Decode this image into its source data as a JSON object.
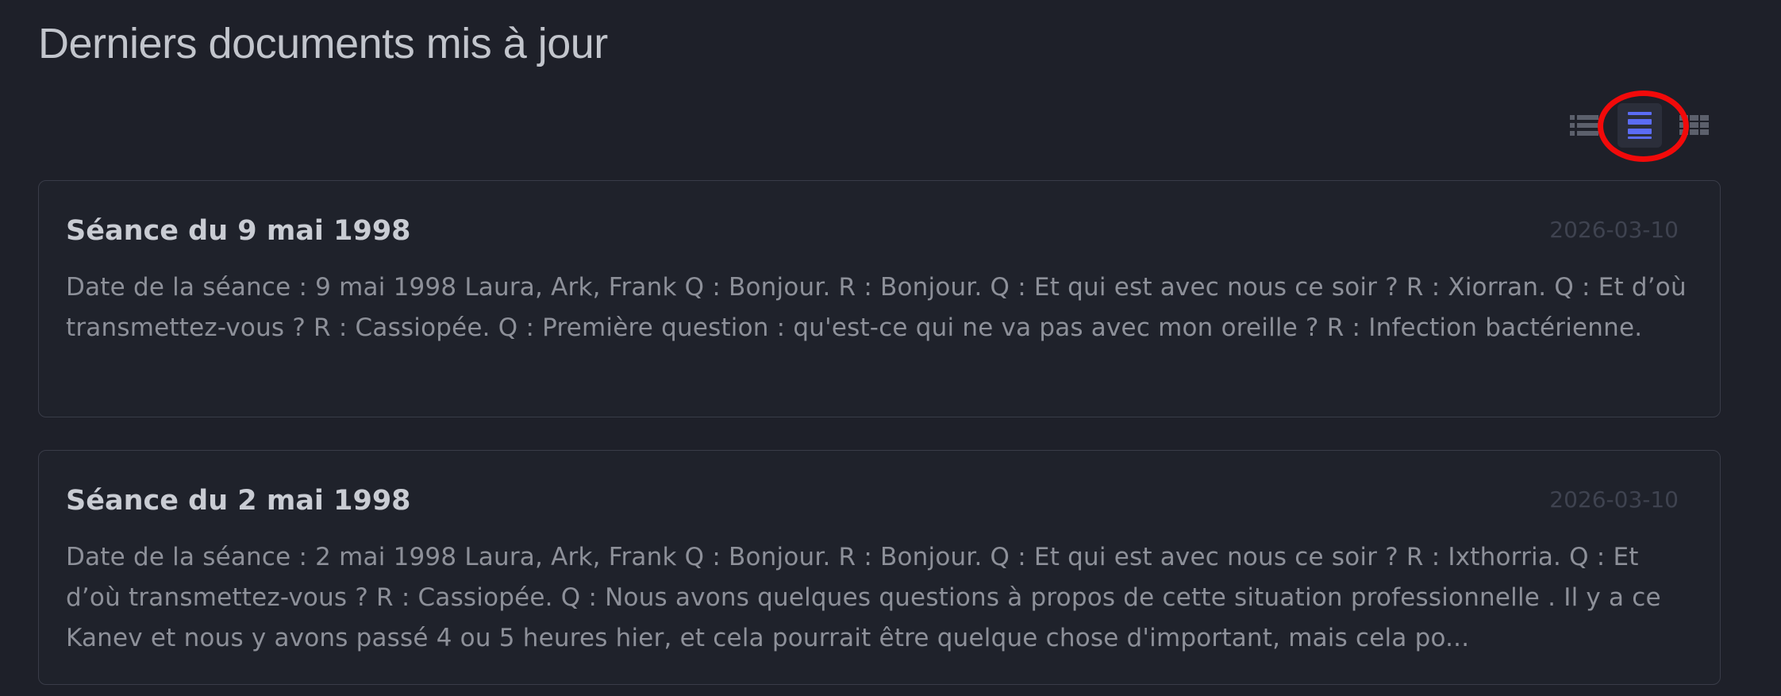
{
  "page": {
    "title": "Derniers documents mis à jour"
  },
  "view_switcher": {
    "options": [
      {
        "icon": "list-view-icon",
        "active": false
      },
      {
        "icon": "card-view-icon",
        "active": true
      },
      {
        "icon": "grid-view-icon",
        "active": false
      }
    ],
    "highlight_color": "#f20a0a",
    "active_color": "#5b6cf5"
  },
  "documents": [
    {
      "title": "Séance du 9 mai 1998",
      "date": "2026-03-10",
      "excerpt": "Date de la séance : 9 mai 1998 Laura, Ark, Frank Q : Bonjour. R : Bonjour. Q : Et qui est avec nous ce soir ? R : Xiorran. Q : Et d’où transmettez-vous ? R : Cassiopée. Q : Première question : qu'est-ce qui ne va pas avec mon oreille ? R : Infection bactérienne."
    },
    {
      "title": "Séance du 2 mai 1998",
      "date": "2026-03-10",
      "excerpt": "Date de la séance : 2 mai 1998 Laura, Ark, Frank Q : Bonjour. R : Bonjour. Q : Et qui est avec nous ce soir ? R : Ixthorria. Q : Et d’où transmettez-vous ? R : Cassiopée. Q : Nous avons quelques questions à propos de cette situation professionnelle . Il y a ce Kanev et nous y avons passé 4 ou 5 heures hier, et cela pourrait être quelque chose d'important, mais cela po..."
    }
  ]
}
